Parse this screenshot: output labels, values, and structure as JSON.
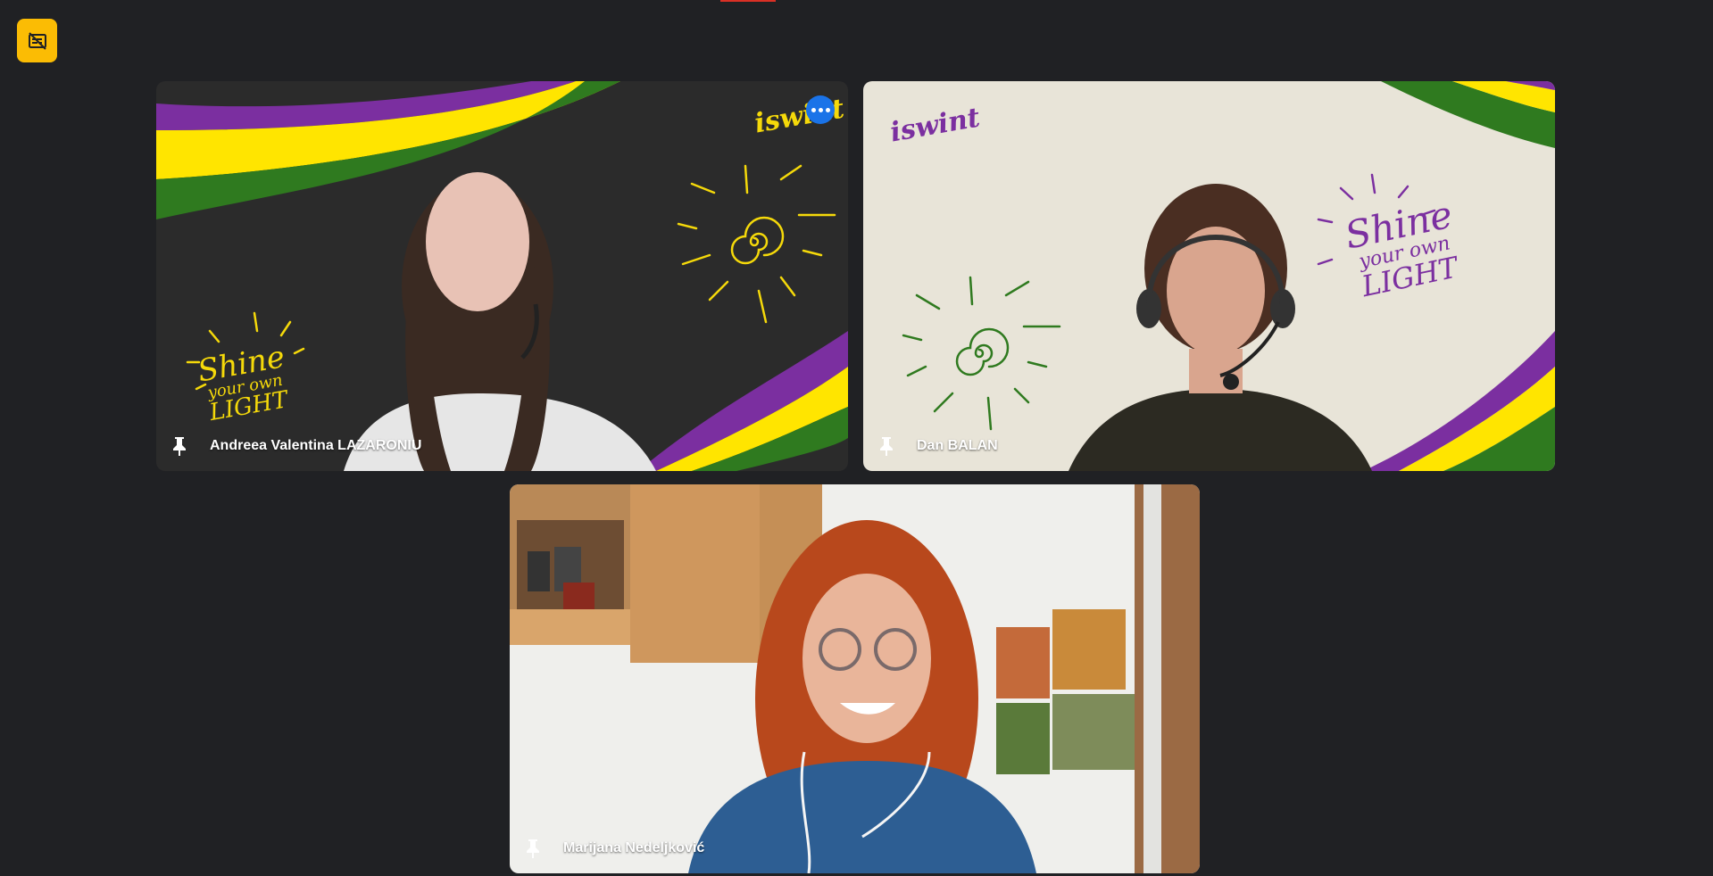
{
  "controls": {
    "captions_off_icon": "captions-off-icon"
  },
  "participants": [
    {
      "name": "Andreea Valentina LAZARONIU",
      "pin_icon": "pin-icon",
      "background_logo": "iswint",
      "background_text": [
        "Shine",
        "your own",
        "LIGHT"
      ],
      "colors": {
        "bg": "#2b2b2b",
        "stripe1": "#7b2fa0",
        "stripe2": "#ffe500",
        "stripe3": "#2f7a1f",
        "doodle": "#f5d90a"
      }
    },
    {
      "name": "Dan BALAN",
      "pin_icon": "pin-icon",
      "background_logo": "iswint",
      "background_text": [
        "Shine",
        "your own",
        "LIGHT"
      ],
      "colors": {
        "bg": "#e8e4d8",
        "stripe1": "#7b2fa0",
        "stripe2": "#ffe500",
        "stripe3": "#2f7a1f",
        "doodle": "#2f7a1f",
        "text": "#7b2fa0"
      }
    },
    {
      "name": "Marijana Nedeljković",
      "pin_icon": "pin-icon",
      "colors": {
        "wall": "#efefec",
        "cabinet": "#c58f56",
        "hair": "#b8481c",
        "shirt": "#2d5e93"
      }
    }
  ]
}
